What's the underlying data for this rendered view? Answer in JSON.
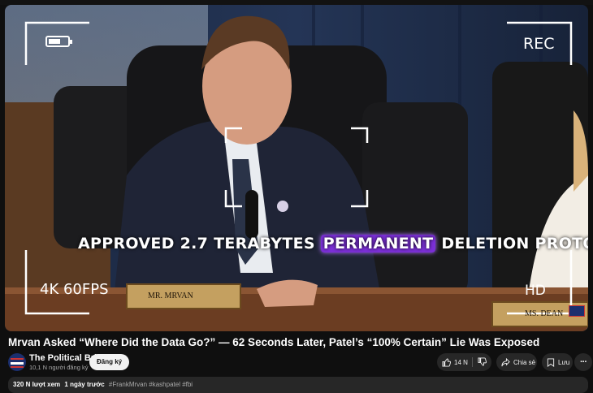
{
  "video": {
    "overlay": {
      "rec_label": "REC",
      "format_label": "4K 60FPS",
      "quality_label": "HD",
      "caption_prefix": "APPROVED 2.7 TERABYTES",
      "caption_highlight": "PERMANENT",
      "caption_suffix": "DELETION PROTOCOL",
      "nameplate_left": "MR. MRVAN",
      "nameplate_right": "MS. DEAN"
    },
    "title": "Mrvan Asked “Where Did the Data Go?” — 62 Seconds Later, Patel’s “100% Certain” Lie Was Exposed"
  },
  "channel": {
    "name": "The Political Brief",
    "subscribers": "10,1 N người đăng ký",
    "subscribe_label": "Đăng ký"
  },
  "actions": {
    "like_count": "14 N",
    "share_label": "Chia sẻ",
    "save_label": "Lưu"
  },
  "description": {
    "views": "320 N lượt xem",
    "age": "1 ngày trước",
    "hashtags": "#FrankMrvan #kashpatel #fbi"
  },
  "icons": [
    "battery-icon",
    "like-icon",
    "dislike-icon",
    "share-icon",
    "save-icon",
    "more-icon"
  ],
  "colors": {
    "caption_highlight": "#7b2fd6",
    "background": "#0f0f0f",
    "pill": "#272727"
  }
}
